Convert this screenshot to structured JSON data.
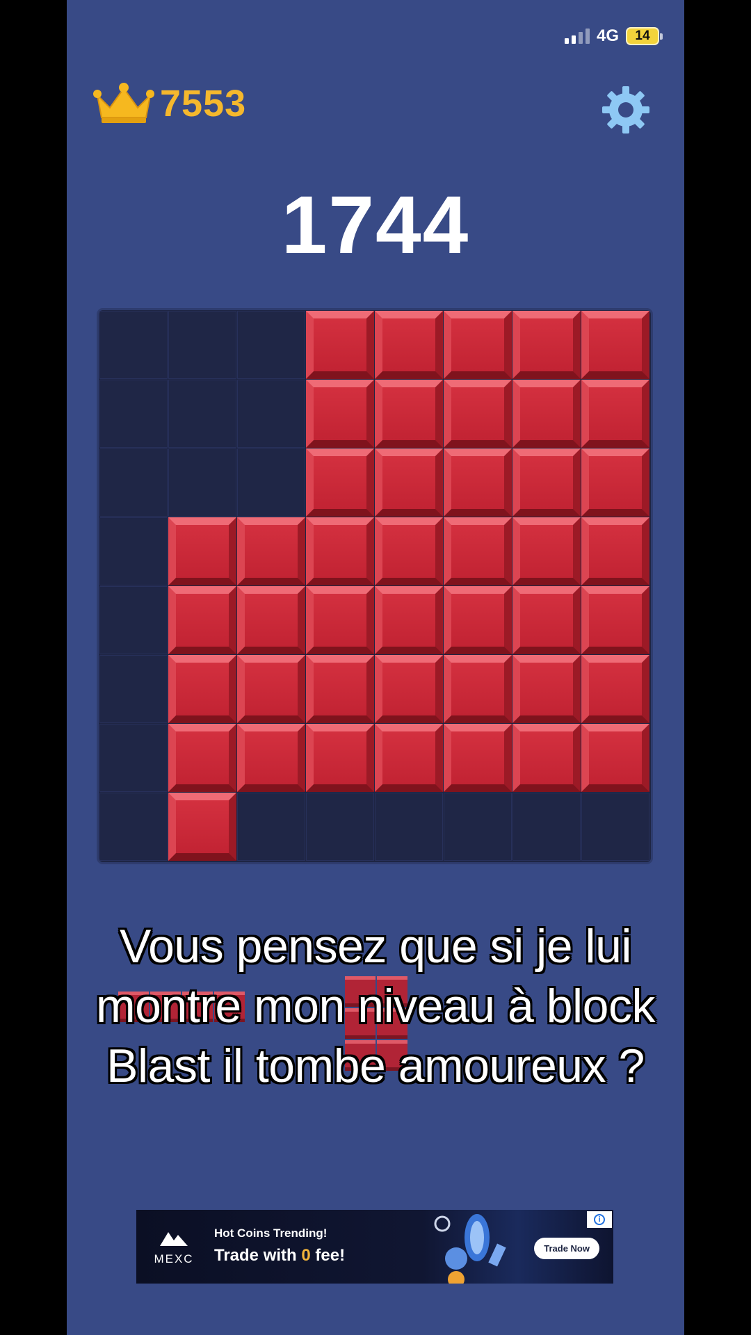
{
  "status_bar": {
    "network": "4G",
    "battery": "14"
  },
  "header": {
    "best_score": "7553",
    "score": "1744"
  },
  "icons": {
    "best": "crown-icon",
    "settings": "gear-icon"
  },
  "colors": {
    "background": "#384a86",
    "block": "#c92636",
    "board": "#1e2544",
    "best_score": "#f5b82d"
  },
  "board": {
    "size": 8,
    "rows": [
      [
        0,
        0,
        0,
        1,
        1,
        1,
        1,
        1
      ],
      [
        0,
        0,
        0,
        1,
        1,
        1,
        1,
        1
      ],
      [
        0,
        0,
        0,
        1,
        1,
        1,
        1,
        1
      ],
      [
        0,
        1,
        1,
        1,
        1,
        1,
        1,
        1
      ],
      [
        0,
        1,
        1,
        1,
        1,
        1,
        1,
        1
      ],
      [
        0,
        1,
        1,
        1,
        1,
        1,
        1,
        1
      ],
      [
        0,
        1,
        1,
        1,
        1,
        1,
        1,
        1
      ],
      [
        0,
        1,
        0,
        0,
        0,
        0,
        0,
        0
      ]
    ]
  },
  "caption": {
    "line1": "Vous pensez que si je lui",
    "line2": "montre mon niveau à block",
    "line3": "Blast il tombe amoureux ?"
  },
  "ad": {
    "brand": "MEXC",
    "line1": "Hot Coins Trending!",
    "line2_prefix": "Trade with ",
    "line2_highlight": "0",
    "line2_suffix": " fee!",
    "cta": "Trade Now"
  }
}
